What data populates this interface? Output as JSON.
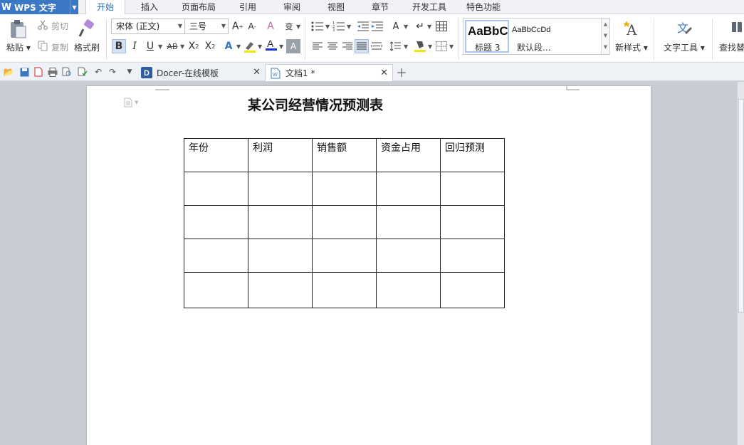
{
  "app": {
    "title": "WPS 文字"
  },
  "menu": {
    "tabs": [
      {
        "label": "开始",
        "active": true
      },
      {
        "label": "插入"
      },
      {
        "label": "页面布局"
      },
      {
        "label": "引用"
      },
      {
        "label": "审阅"
      },
      {
        "label": "视图"
      },
      {
        "label": "章节"
      },
      {
        "label": "开发工具"
      },
      {
        "label": "特色功能"
      }
    ]
  },
  "ribbon": {
    "paste": "粘贴",
    "cut": "剪切",
    "copy": "复制",
    "format_painter": "格式刷",
    "font_name": "宋体 (正文)",
    "font_size": "三号",
    "styles": [
      {
        "preview": "AaBbC",
        "name": "标题 3"
      },
      {
        "preview": "AaBbCcDd",
        "name": "默认段..."
      }
    ],
    "new_style": "新样式",
    "text_tools": "文字工具",
    "find_replace": "查找替"
  },
  "tabs": {
    "docer": "Docer-在线模板",
    "doc1": "文档1 *"
  },
  "document": {
    "title": "某公司经营情况预测表",
    "table": {
      "headers": [
        "年份",
        "利润",
        "销售额",
        "资金占用",
        "回归预测"
      ],
      "empty_rows": 4
    }
  },
  "colors": {
    "accent": "#2a6ebb",
    "app_button": "#3b78c4"
  }
}
